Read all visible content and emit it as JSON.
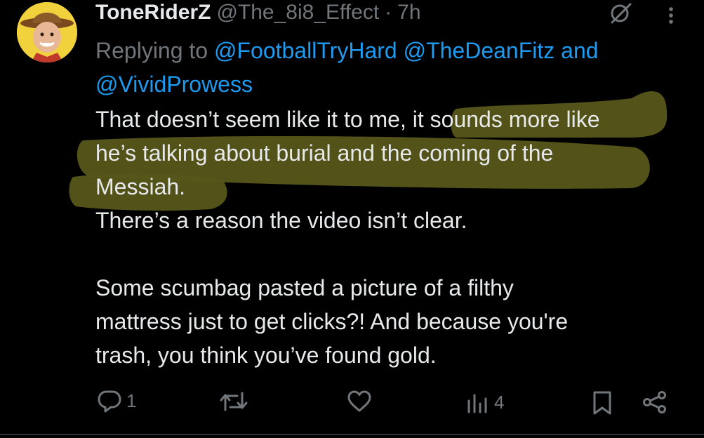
{
  "tweet": {
    "display_name": "ToneRiderZ",
    "handle": "@The_8i8_Effect",
    "separator": "·",
    "time": "7h",
    "replying_prefix": "Replying to",
    "mention_1": "@FootballTryHard",
    "mention_2": "@TheDeanFitz",
    "mention_joiner": "and",
    "mention_3": "@VividProwess",
    "body": {
      "line1": "That doesn’t seem like it to me, it sounds more like",
      "line2": "he’s talking about burial and the coming of the",
      "line3": "Messiah.",
      "line4": "There’s a reason the video isn’t clear.",
      "para2_line1": "Some scumbag pasted a picture of a filthy",
      "para2_line2": "mattress just to get clicks?! And because you're",
      "para2_line3": "trash, you think you’ve found gold."
    },
    "highlight_color": "#5a5a12"
  },
  "actions": {
    "reply_count": "1",
    "retweet_count": "",
    "like_count": "",
    "views_count": "4"
  },
  "icons": [
    "avatar",
    "grok-icon",
    "more-icon",
    "reply-icon",
    "retweet-icon",
    "like-icon",
    "views-icon",
    "bookmark-icon",
    "share-icon"
  ]
}
